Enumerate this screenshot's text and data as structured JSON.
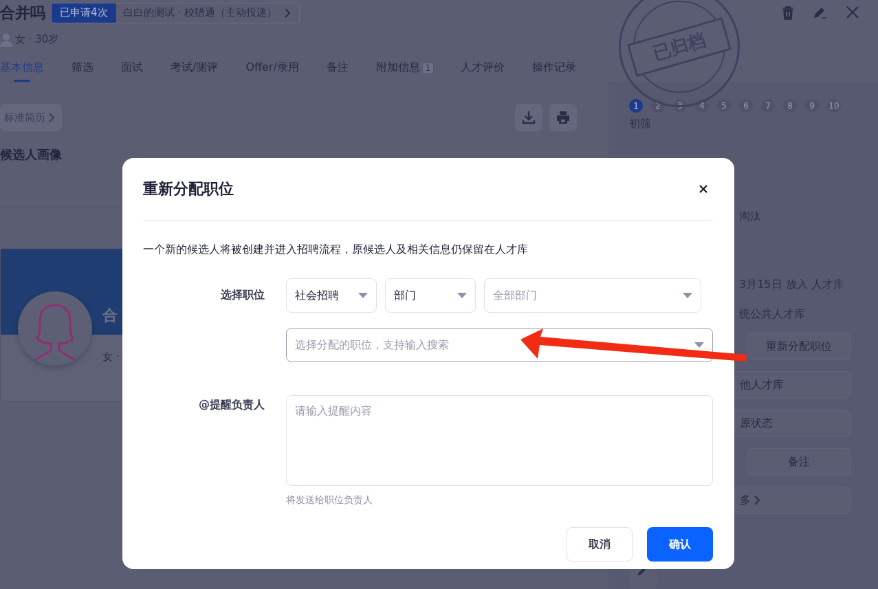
{
  "header": {
    "name": "合并吗",
    "applied_badge": "已申请4次",
    "source": "白白的测试 · 校猎通（主动投递）",
    "profile": "女 · 30岁",
    "stamp": "已归档"
  },
  "tabs": [
    {
      "label": "基本信息",
      "selected": true
    },
    {
      "label": "筛选",
      "selected": false
    },
    {
      "label": "面试",
      "selected": false
    },
    {
      "label": "考试/测评",
      "selected": false
    },
    {
      "label": "Offer/录用",
      "selected": false
    },
    {
      "label": "备注",
      "selected": false
    },
    {
      "label": "附加信息",
      "selected": false,
      "badge": "1"
    },
    {
      "label": "人才评价",
      "selected": false
    },
    {
      "label": "操作记录",
      "selected": false
    }
  ],
  "resume": {
    "button": "标准简历",
    "heading": "候选人画像",
    "card_name": "合",
    "card_info": "女 ·"
  },
  "progress": {
    "steps": [
      {
        "label": "1",
        "selected": true
      },
      {
        "label": "2",
        "selected": false
      },
      {
        "label": "3",
        "selected": false
      },
      {
        "label": "4",
        "selected": false
      },
      {
        "label": "5",
        "selected": false
      },
      {
        "label": "6",
        "selected": false
      },
      {
        "label": "7",
        "selected": false
      },
      {
        "label": "8",
        "selected": false
      },
      {
        "label": "9",
        "selected": false
      },
      {
        "label": "10",
        "selected": false
      }
    ],
    "stage": "初筛"
  },
  "side": {
    "lines": [
      "淘汰",
      "3月15日 放入 人才库",
      "统公共人才库"
    ],
    "actions": [
      {
        "label": "重新分配职位",
        "kind": "half"
      },
      {
        "label": "他人才库",
        "kind": "wide"
      },
      {
        "label": "原状态",
        "kind": "wide"
      },
      {
        "label": "备注",
        "kind": "half"
      },
      {
        "label": "多",
        "kind": "more"
      }
    ]
  },
  "dialog": {
    "title": "重新分配职位",
    "description": "一个新的候选人将被创建并进入招聘流程，原候选人及相关信息仍保留在人才库",
    "position_label": "选择职位",
    "selects": [
      {
        "value": "社会招聘"
      },
      {
        "value": "部门"
      },
      {
        "placeholder": "全部部门"
      }
    ],
    "position_select": {
      "placeholder": "选择分配的职位，支持输入搜索"
    },
    "remind_label": "@提醒负责人",
    "remind_field": {
      "placeholder": "请输入提醒内容"
    },
    "hint": "将发送给职位负责人",
    "buttons": [
      {
        "label": "取消",
        "kind": "secondary"
      },
      {
        "label": "确认",
        "kind": "primary"
      }
    ]
  }
}
